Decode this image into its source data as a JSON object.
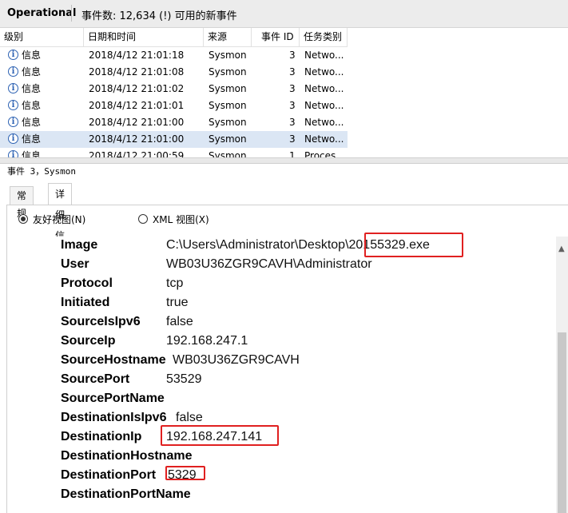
{
  "titlebar": {
    "log_name": "Operational",
    "event_count": "事件数: 12,634 (!) 可用的新事件"
  },
  "event_list": {
    "columns": [
      "级别",
      "日期和时间",
      "来源",
      "事件 ID",
      "任务类别"
    ],
    "rows": [
      {
        "level": "信息",
        "datetime": "2018/4/12 21:01:18",
        "source": "Sysmon",
        "id": "3",
        "task": "Netwo..."
      },
      {
        "level": "信息",
        "datetime": "2018/4/12 21:01:08",
        "source": "Sysmon",
        "id": "3",
        "task": "Netwo..."
      },
      {
        "level": "信息",
        "datetime": "2018/4/12 21:01:02",
        "source": "Sysmon",
        "id": "3",
        "task": "Netwo..."
      },
      {
        "level": "信息",
        "datetime": "2018/4/12 21:01:01",
        "source": "Sysmon",
        "id": "3",
        "task": "Netwo..."
      },
      {
        "level": "信息",
        "datetime": "2018/4/12 21:01:00",
        "source": "Sysmon",
        "id": "3",
        "task": "Netwo..."
      },
      {
        "level": "信息",
        "datetime": "2018/4/12 21:01:00",
        "source": "Sysmon",
        "id": "3",
        "task": "Netwo..."
      },
      {
        "level": "信息",
        "datetime": "2018/4/12 21:00:59",
        "source": "Sysmon",
        "id": "1",
        "task": "Proces..."
      }
    ],
    "selected_row_index": 5
  },
  "detail": {
    "title": "事件 3，Sysmon",
    "tabs": [
      "常规",
      "详细信息"
    ],
    "active_tab": "详细信息",
    "view_options": {
      "friendly": "友好视图(N)",
      "xml": "XML 视图(X)",
      "selected": "friendly"
    },
    "fields": [
      {
        "key": "Image",
        "value": "C:\\Users\\Administrator\\Desktop\\20155329.exe"
      },
      {
        "key": "User",
        "value": "WB03U36ZGR9CAVH\\Administrator"
      },
      {
        "key": "Protocol",
        "value": "tcp"
      },
      {
        "key": "Initiated",
        "value": "true"
      },
      {
        "key": "SourceIsIpv6",
        "value": "false"
      },
      {
        "key": "SourceIp",
        "value": "192.168.247.1"
      },
      {
        "key": "SourceHostname",
        "value": "WB03U36ZGR9CAVH"
      },
      {
        "key": "SourcePort",
        "value": "53529"
      },
      {
        "key": "SourcePortName",
        "value": ""
      },
      {
        "key": "DestinationIsIpv6",
        "value": "false"
      },
      {
        "key": "DestinationIp",
        "value": "192.168.247.141"
      },
      {
        "key": "DestinationHostname",
        "value": ""
      },
      {
        "key": "DestinationPort",
        "value": "5329"
      },
      {
        "key": "DestinationPortName",
        "value": ""
      }
    ]
  },
  "colors": {
    "highlight": "#e02020",
    "selected_row": "#dbe6f4",
    "info_icon": "#2d62b3"
  },
  "icons": {
    "level_info": "info-circle-icon",
    "scroll_up": "chevron-up-icon"
  }
}
